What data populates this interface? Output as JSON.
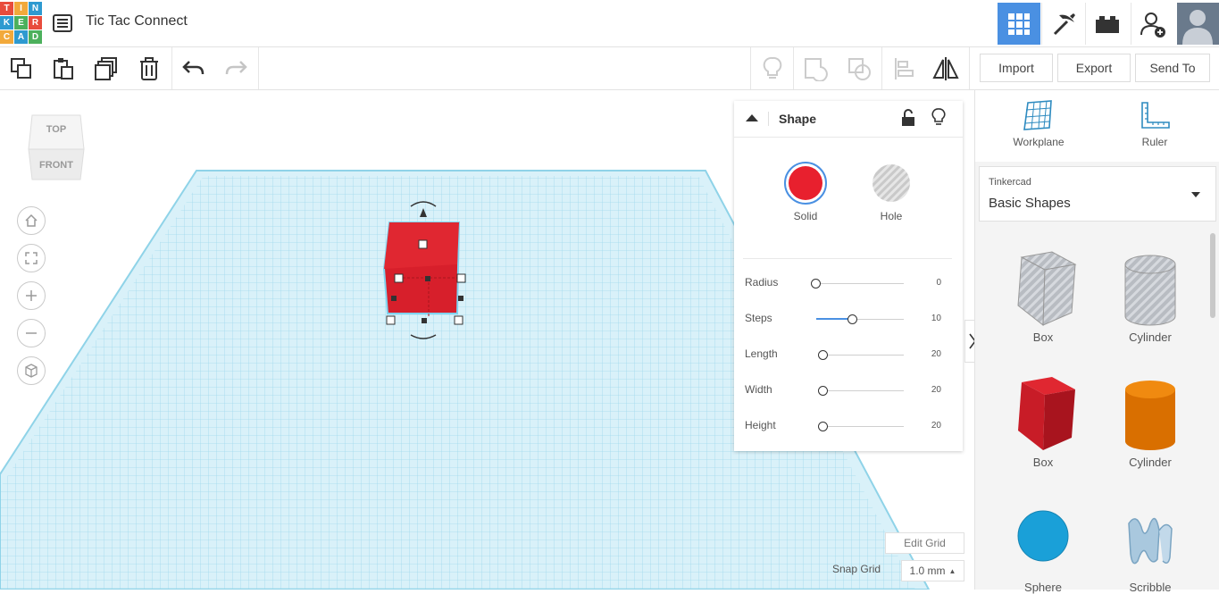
{
  "header": {
    "logo_letters": [
      "T",
      "I",
      "N",
      "K",
      "E",
      "R",
      "C",
      "A",
      "D"
    ],
    "logo_colors": [
      "#e84c3d",
      "#f2a93b",
      "#f2c83b",
      "#4cb05c",
      "#2e9ad0",
      "#2e9ad0",
      "#e84c3d",
      "#f2a93b",
      "#4cb05c"
    ],
    "title": "Tic Tac Connect",
    "icons": [
      "design-list-icon",
      "grid-view-icon",
      "pickaxe-icon",
      "bricks-icon",
      "add-user-icon",
      "avatar"
    ]
  },
  "toolbar": {
    "import_label": "Import",
    "export_label": "Export",
    "sendto_label": "Send To"
  },
  "viewcube": {
    "top": "TOP",
    "front": "FRONT"
  },
  "inspector": {
    "title": "Shape",
    "solid_label": "Solid",
    "hole_label": "Hole",
    "solid_color": "#e8202e",
    "params": [
      {
        "label": "Radius",
        "value": "0",
        "level": 0.0
      },
      {
        "label": "Steps",
        "value": "10",
        "level": 0.5
      },
      {
        "label": "Length",
        "value": "20",
        "level": 0.0
      },
      {
        "label": "Width",
        "value": "20",
        "level": 0.0
      },
      {
        "label": "Height",
        "value": "20",
        "level": 0.0
      }
    ]
  },
  "grid_controls": {
    "edit_grid_label": "Edit Grid",
    "snap_grid_label": "Snap Grid",
    "snap_grid_value": "1.0 mm"
  },
  "rightpanel": {
    "workplane_label": "Workplane",
    "ruler_label": "Ruler",
    "library_source": "Tinkercad",
    "library_name": "Basic Shapes",
    "shapes": [
      {
        "label": "Box",
        "kind": "box-hole"
      },
      {
        "label": "Cylinder",
        "kind": "cylinder-hole"
      },
      {
        "label": "Box",
        "kind": "box-solid"
      },
      {
        "label": "Cylinder",
        "kind": "cylinder-solid"
      },
      {
        "label": "Sphere",
        "kind": "sphere"
      },
      {
        "label": "Scribble",
        "kind": "scribble"
      }
    ]
  },
  "colors": {
    "accent_blue": "#4a90e2",
    "grid_blue": "#8fd3e8",
    "box_red": "#d71f2b",
    "cylinder_orange": "#e67e00",
    "sphere_blue": "#1aa0d8"
  }
}
